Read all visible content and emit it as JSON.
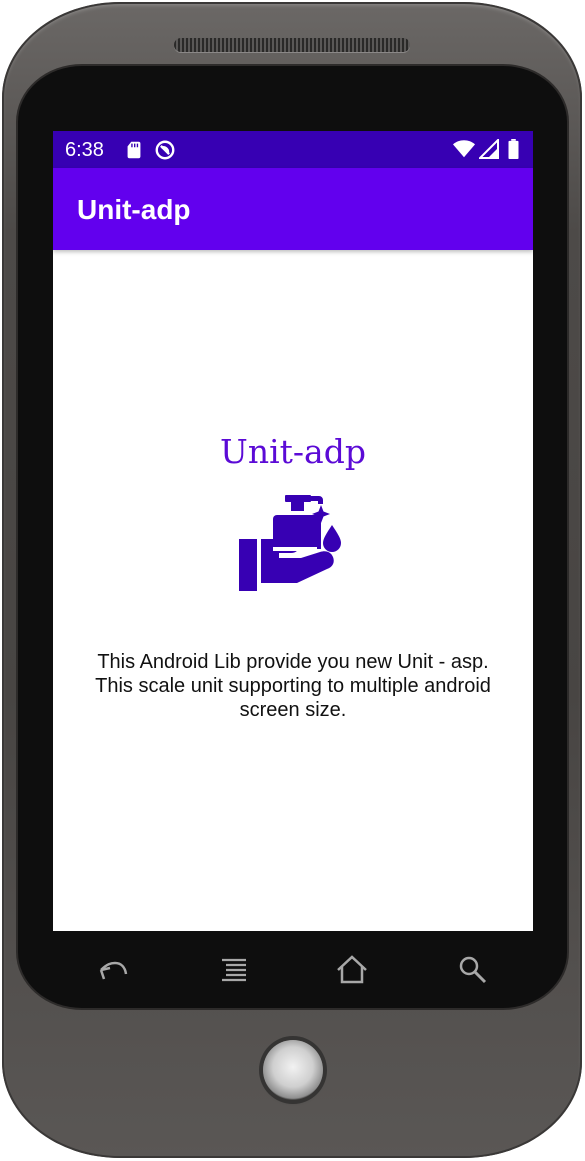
{
  "status_bar": {
    "time": "6:38",
    "left_icons": [
      "sd-card-icon",
      "do-not-disturb-icon"
    ],
    "right_icons": [
      "wifi-icon",
      "signal-icon",
      "battery-icon"
    ],
    "color": "#3700b3"
  },
  "app_bar": {
    "title": "Unit-adp",
    "color": "#6200ee"
  },
  "content": {
    "title": "Unit-adp",
    "icon": "hand-wash-icon",
    "description": "This Android Lib provide you new Unit - asp. This scale unit supporting to multiple android screen size.",
    "accent_color": "#5b0ad6",
    "icon_color": "#3700b3"
  },
  "nav_bar": {
    "buttons": [
      "back-icon",
      "menu-icon",
      "home-icon",
      "search-icon"
    ]
  }
}
